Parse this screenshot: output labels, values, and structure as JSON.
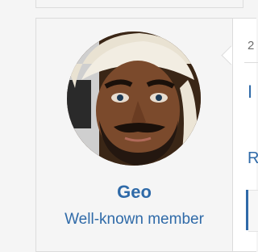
{
  "member": {
    "username": "Geo",
    "title": "Well-known member"
  },
  "post": {
    "date_fragment": "2",
    "link_fragment_1": "I",
    "link_fragment_2": "R"
  }
}
